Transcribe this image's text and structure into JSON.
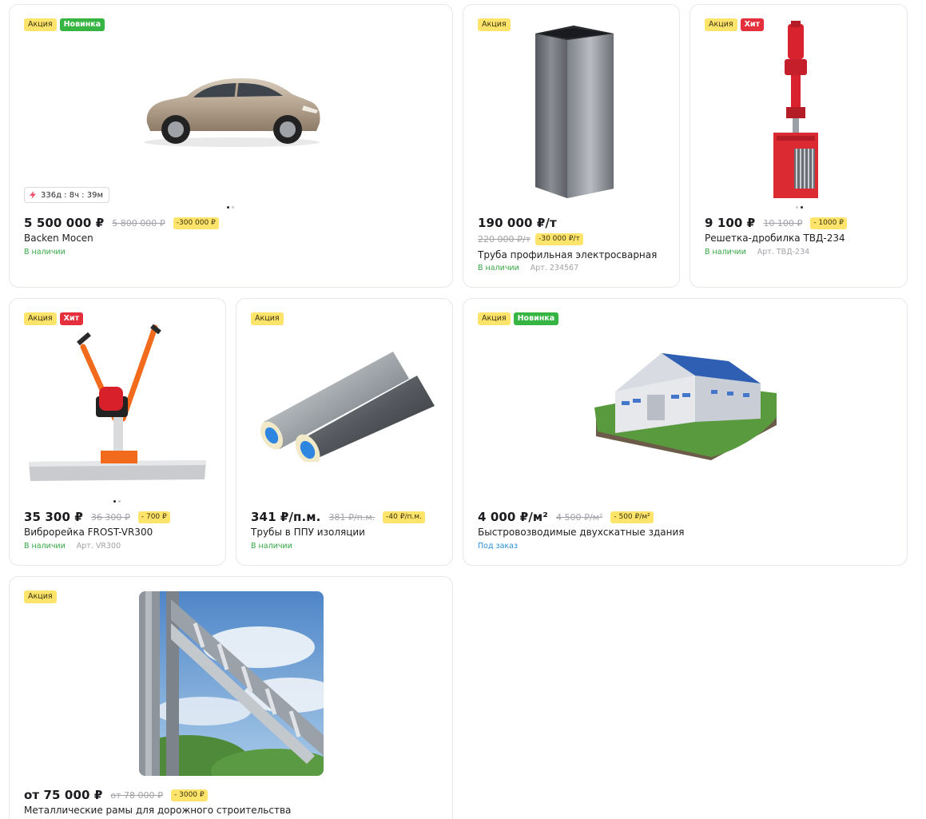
{
  "colors": {
    "sale_badge": "#ffe46b",
    "new_badge": "#36b543",
    "hit_badge": "#e4303c",
    "in_stock": "#36a845",
    "on_order": "#2b8fd9"
  },
  "products": [
    {
      "badges": [
        "Акция",
        "Новинка"
      ],
      "timer": "336д : 8ч : 39м",
      "price": "5 500 000 ₽",
      "old_price": "5 800 000 ₽",
      "discount": "-300 000 ₽",
      "name": "Backen Mocen",
      "availability": "В наличии",
      "image_icon": "car-icon"
    },
    {
      "badges": [
        "Акция"
      ],
      "price": "190 000 ₽/т",
      "old_price": "220 000 ₽/т",
      "discount": "-30 000 ₽/т",
      "name": "Труба профильная электросварная",
      "availability": "В наличии",
      "article": "Арт. 234567",
      "image_icon": "steel-tube-icon"
    },
    {
      "badges": [
        "Акция",
        "Хит"
      ],
      "price": "9 100 ₽",
      "old_price": "10 100 ₽",
      "discount": "- 1000 ₽",
      "name": "Решетка-дробилка ТВД-234",
      "availability": "В наличии",
      "article": "Арт. ТВД-234",
      "image_icon": "crusher-icon"
    },
    {
      "badges": [
        "Акция",
        "Хит"
      ],
      "price": "35 300 ₽",
      "old_price": "36 300 ₽",
      "discount": "- 700 ₽",
      "name": "Виброрейка FROST-VR300",
      "availability": "В наличии",
      "article": "Арт. VR300",
      "image_icon": "vibrating-screed-icon"
    },
    {
      "badges": [
        "Акция"
      ],
      "price": "341 ₽/п.м.",
      "old_price": "381 ₽/п.м.",
      "discount": "-40 ₽/п.м.",
      "name": "Трубы в ППУ изоляции",
      "availability": "В наличии",
      "image_icon": "insulated-pipes-icon"
    },
    {
      "badges": [
        "Акция",
        "Новинка"
      ],
      "price": "4 000 ₽/м²",
      "old_price": "4 500 ₽/м²",
      "discount": "- 500 ₽/м²",
      "name": "Быстровозводимые двухскатные здания",
      "availability": "Под заказ",
      "image_icon": "warehouse-icon"
    },
    {
      "badges": [
        "Акция"
      ],
      "price": "от 75 000 ₽",
      "old_price": "от 78 000 ₽",
      "discount": "- 3000 ₽",
      "name": "Металлические рамы для дорожного строительства",
      "image_icon": "road-frame-icon"
    }
  ]
}
